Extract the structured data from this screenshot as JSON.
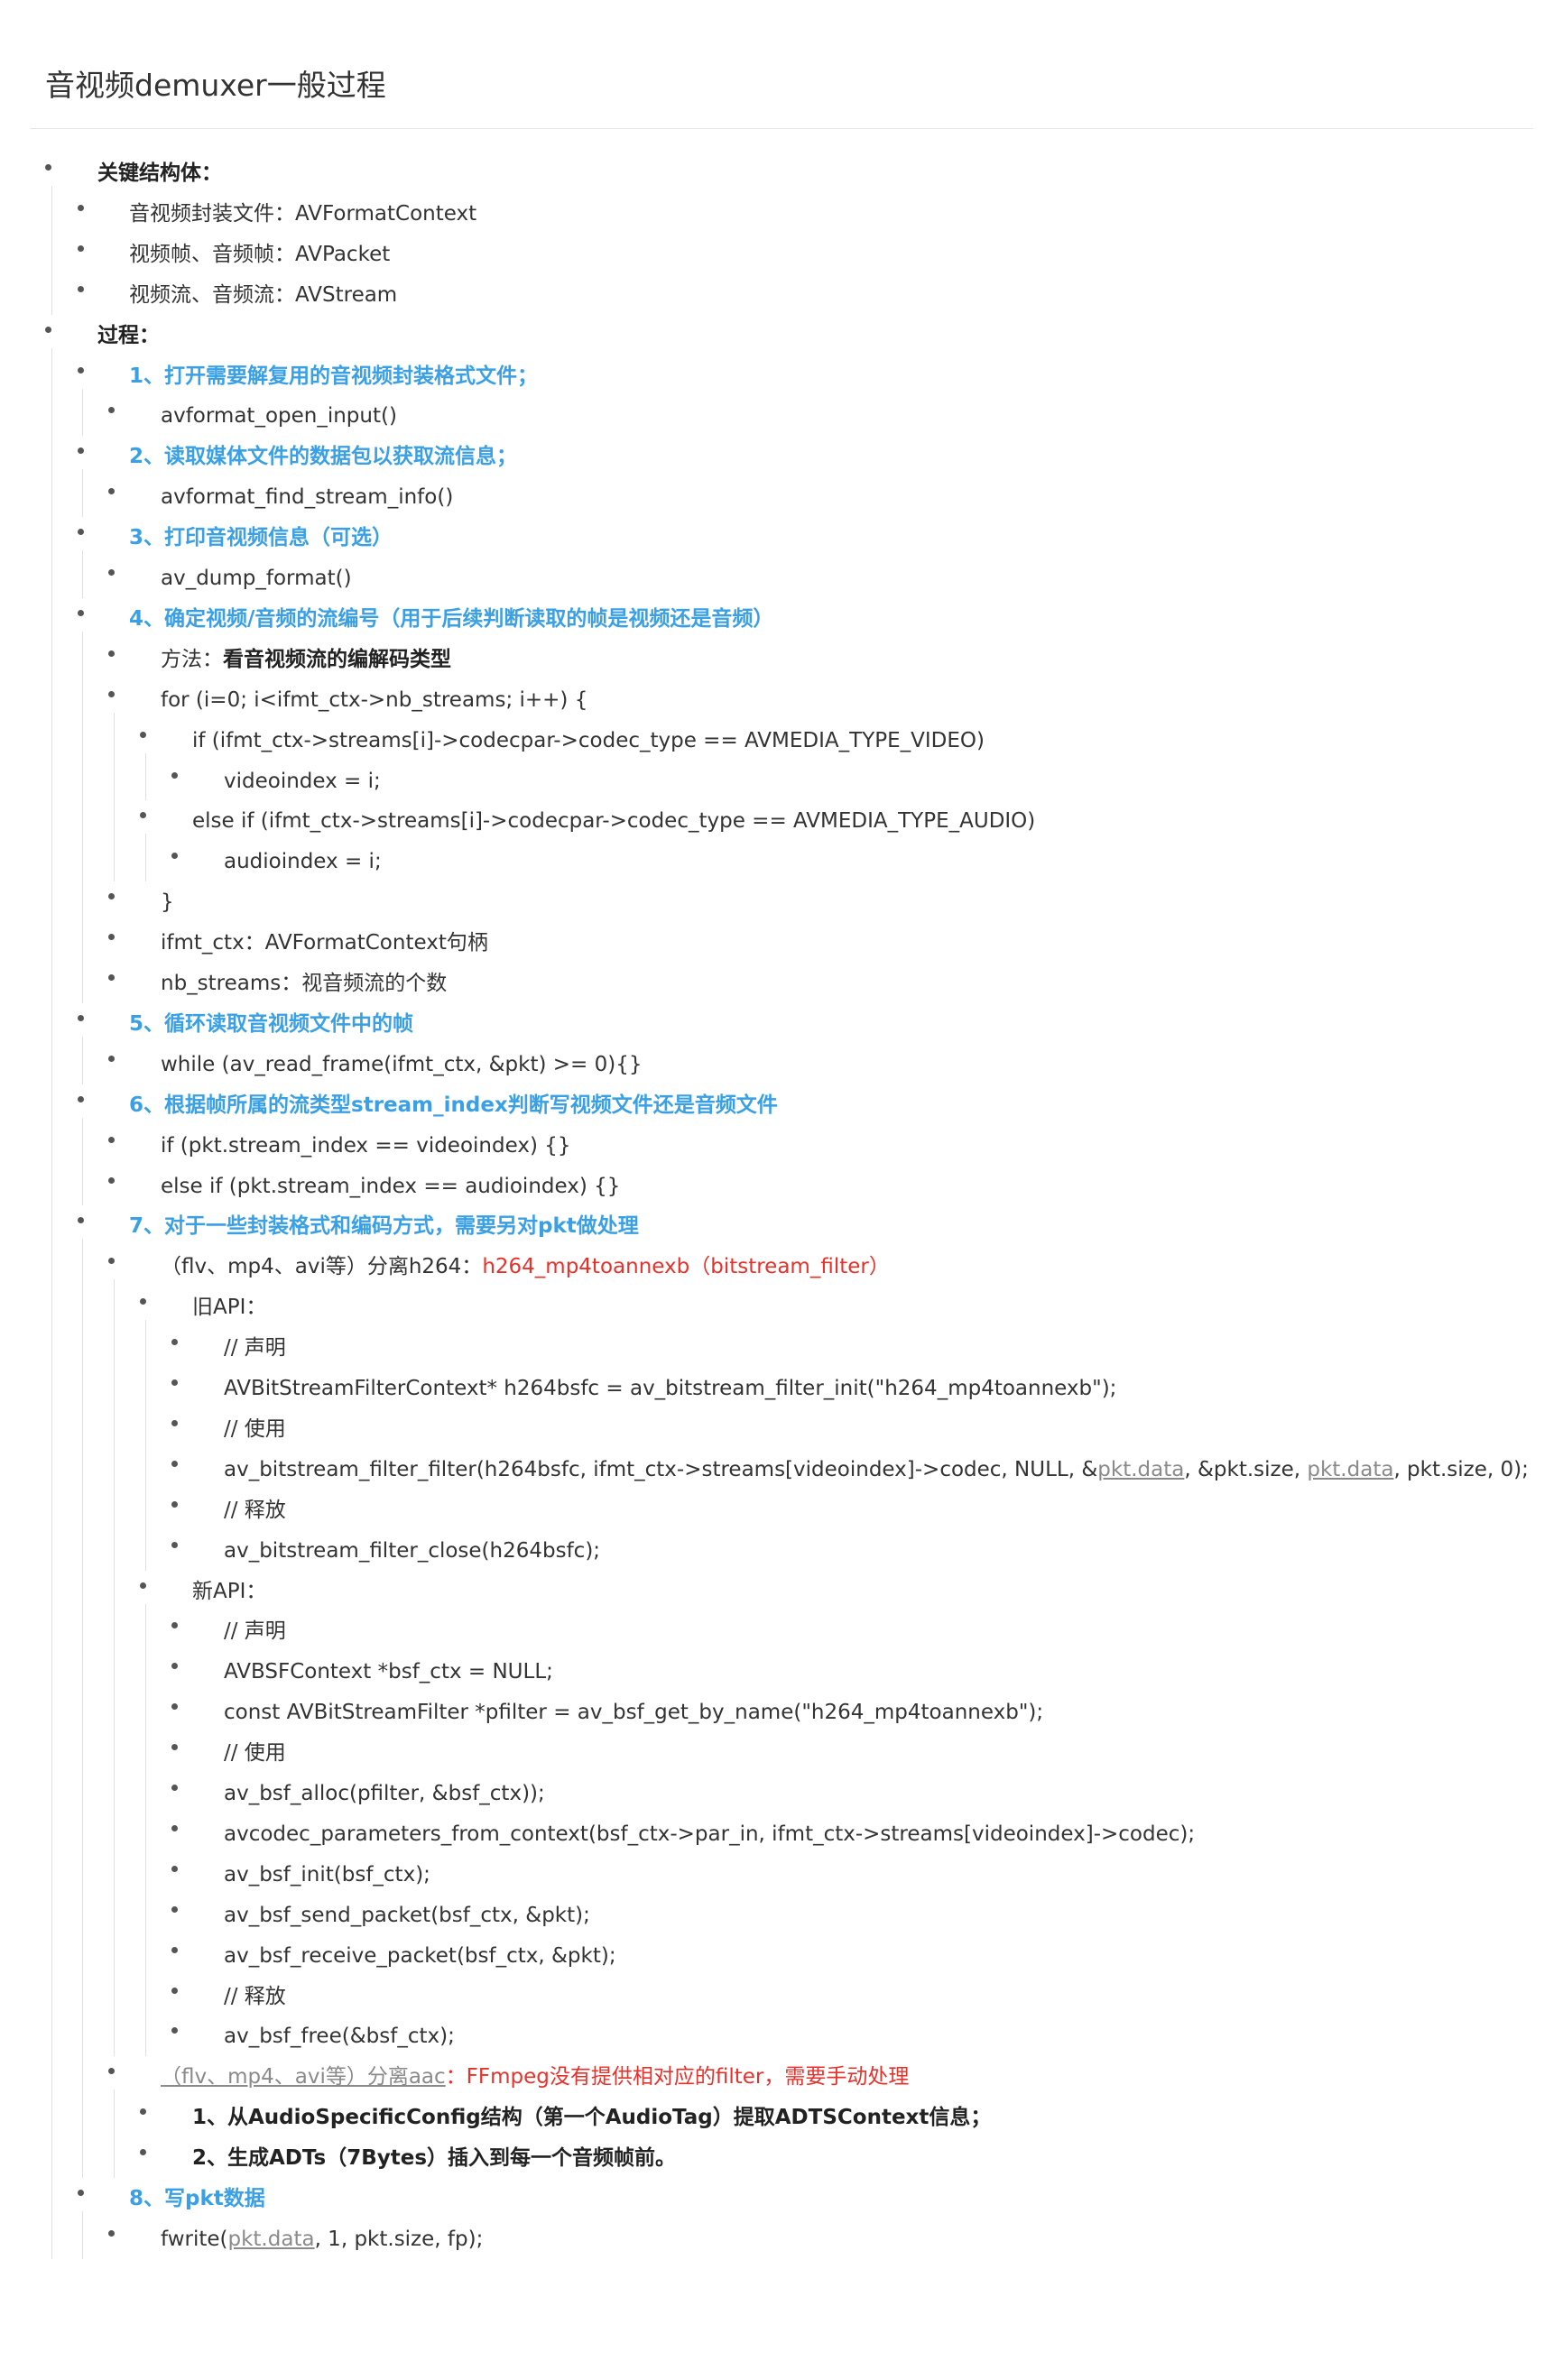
{
  "title": "音视频demuxer一般过程",
  "colors": {
    "heading_blue": "#3aa0e6",
    "emphasis_red": "#e8312a",
    "text": "#333333",
    "link_grey": "#8a8a8a"
  },
  "items": [
    {
      "level": 0,
      "segments": [
        {
          "t": "关键结构体：",
          "s": "bold"
        }
      ]
    },
    {
      "level": 1,
      "segments": [
        {
          "t": "音视频封装文件：AVFormatContext"
        }
      ]
    },
    {
      "level": 1,
      "segments": [
        {
          "t": "视频帧、音频帧：AVPacket"
        }
      ]
    },
    {
      "level": 1,
      "segments": [
        {
          "t": "视频流、音频流：AVStream"
        }
      ]
    },
    {
      "level": 0,
      "segments": [
        {
          "t": "过程：",
          "s": "bold"
        }
      ]
    },
    {
      "level": 1,
      "segments": [
        {
          "t": "1、打开需要解复用的音视频封装格式文件；",
          "s": "blue"
        }
      ]
    },
    {
      "level": 2,
      "segments": [
        {
          "t": "avformat_open_input()"
        }
      ]
    },
    {
      "level": 1,
      "segments": [
        {
          "t": "2、读取媒体文件的数据包以获取流信息；",
          "s": "blue"
        }
      ]
    },
    {
      "level": 2,
      "segments": [
        {
          "t": "avformat_find_stream_info()"
        }
      ]
    },
    {
      "level": 1,
      "segments": [
        {
          "t": "3、打印音视频信息（可选）",
          "s": "blue"
        }
      ]
    },
    {
      "level": 2,
      "segments": [
        {
          "t": "av_dump_format()"
        }
      ]
    },
    {
      "level": 1,
      "segments": [
        {
          "t": "4、确定视频/音频的流编号（用于后续判断读取的帧是视频还是音频）",
          "s": "blue"
        }
      ]
    },
    {
      "level": 2,
      "segments": [
        {
          "t": "方法："
        },
        {
          "t": "看音视频流的编解码类型",
          "s": "strong"
        }
      ]
    },
    {
      "level": 2,
      "segments": [
        {
          "t": "for (i=0; i<ifmt_ctx->nb_streams; i++) {"
        }
      ]
    },
    {
      "level": 3,
      "segments": [
        {
          "t": "if (ifmt_ctx->streams[i]->codecpar->codec_type == AVMEDIA_TYPE_VIDEO)"
        }
      ]
    },
    {
      "level": 4,
      "segments": [
        {
          "t": "videoindex = i;"
        }
      ]
    },
    {
      "level": 3,
      "segments": [
        {
          "t": "else if (ifmt_ctx->streams[i]->codecpar->codec_type == AVMEDIA_TYPE_AUDIO)"
        }
      ]
    },
    {
      "level": 4,
      "segments": [
        {
          "t": "audioindex = i;"
        }
      ]
    },
    {
      "level": 2,
      "segments": [
        {
          "t": "}"
        }
      ]
    },
    {
      "level": 2,
      "segments": [
        {
          "t": "ifmt_ctx：AVFormatContext句柄"
        }
      ]
    },
    {
      "level": 2,
      "segments": [
        {
          "t": "nb_streams：视音频流的个数"
        }
      ]
    },
    {
      "level": 1,
      "segments": [
        {
          "t": "5、循环读取音视频文件中的帧",
          "s": "blue"
        }
      ]
    },
    {
      "level": 2,
      "segments": [
        {
          "t": "while (av_read_frame(ifmt_ctx, &pkt) >= 0){}"
        }
      ]
    },
    {
      "level": 1,
      "segments": [
        {
          "t": "6、根据帧所属的流类型stream_index判断写视频文件还是音频文件",
          "s": "blue"
        }
      ]
    },
    {
      "level": 2,
      "segments": [
        {
          "t": "if (pkt.stream_index == videoindex) {}"
        }
      ]
    },
    {
      "level": 2,
      "segments": [
        {
          "t": "else if (pkt.stream_index == audioindex) {}"
        }
      ]
    },
    {
      "level": 1,
      "segments": [
        {
          "t": "7、对于一些封装格式和编码方式，需要另对pkt做处理",
          "s": "blue"
        }
      ]
    },
    {
      "level": 2,
      "segments": [
        {
          "t": "（flv、mp4、avi等）分离h264："
        },
        {
          "t": "h264_mp4toannexb（bitstream_filter）",
          "s": "red"
        }
      ]
    },
    {
      "level": 3,
      "segments": [
        {
          "t": "旧API："
        }
      ]
    },
    {
      "level": 4,
      "segments": [
        {
          "t": "// 声明"
        }
      ]
    },
    {
      "level": 4,
      "segments": [
        {
          "t": "AVBitStreamFilterContext* h264bsfc =  av_bitstream_filter_init(\"h264_mp4toannexb\");"
        }
      ]
    },
    {
      "level": 4,
      "segments": [
        {
          "t": "// 使用"
        }
      ]
    },
    {
      "level": 4,
      "segments": [
        {
          "t": "av_bitstream_filter_filter(h264bsfc, ifmt_ctx->streams[videoindex]->codec, NULL, &"
        },
        {
          "t": "pkt.data",
          "s": "link"
        },
        {
          "t": ", &pkt.size, "
        },
        {
          "t": "pkt.data",
          "s": "link"
        },
        {
          "t": ", pkt.size, 0);"
        }
      ]
    },
    {
      "level": 4,
      "segments": [
        {
          "t": "// 释放"
        }
      ]
    },
    {
      "level": 4,
      "segments": [
        {
          "t": "av_bitstream_filter_close(h264bsfc);"
        }
      ]
    },
    {
      "level": 3,
      "segments": [
        {
          "t": "新API："
        }
      ]
    },
    {
      "level": 4,
      "segments": [
        {
          "t": "// 声明"
        }
      ]
    },
    {
      "level": 4,
      "segments": [
        {
          "t": "AVBSFContext *bsf_ctx = NULL;"
        }
      ]
    },
    {
      "level": 4,
      "segments": [
        {
          "t": "const AVBitStreamFilter *pfilter = av_bsf_get_by_name(\"h264_mp4toannexb\");"
        }
      ]
    },
    {
      "level": 4,
      "segments": [
        {
          "t": "// 使用"
        }
      ]
    },
    {
      "level": 4,
      "segments": [
        {
          "t": "av_bsf_alloc(pfilter, &bsf_ctx));"
        }
      ]
    },
    {
      "level": 4,
      "segments": [
        {
          "t": "avcodec_parameters_from_context(bsf_ctx->par_in, ifmt_ctx->streams[videoindex]->codec);"
        }
      ]
    },
    {
      "level": 4,
      "segments": [
        {
          "t": "av_bsf_init(bsf_ctx);"
        }
      ]
    },
    {
      "level": 4,
      "segments": [
        {
          "t": "av_bsf_send_packet(bsf_ctx, &pkt);"
        }
      ]
    },
    {
      "level": 4,
      "segments": [
        {
          "t": "av_bsf_receive_packet(bsf_ctx, &pkt);"
        }
      ]
    },
    {
      "level": 4,
      "segments": [
        {
          "t": "// 释放"
        }
      ]
    },
    {
      "level": 4,
      "segments": [
        {
          "t": "av_bsf_free(&bsf_ctx);"
        }
      ]
    },
    {
      "level": 2,
      "segments": [
        {
          "t": "（flv、mp4、avi等）分离aac",
          "s": "link"
        },
        {
          "t": "：FFmpeg没有提供相对应的filter，需要手动处理",
          "s": "red"
        }
      ]
    },
    {
      "level": 3,
      "segments": [
        {
          "t": "1、从AudioSpecificConfig结构（第一个AudioTag）提取ADTSContext信息；",
          "s": "strong"
        }
      ]
    },
    {
      "level": 3,
      "segments": [
        {
          "t": "2、生成ADTs（7Bytes）插入到每一个音频帧前。",
          "s": "strong"
        }
      ]
    },
    {
      "level": 1,
      "segments": [
        {
          "t": "8、写pkt数据",
          "s": "blue"
        }
      ]
    },
    {
      "level": 2,
      "segments": [
        {
          "t": "fwrite("
        },
        {
          "t": "pkt.data",
          "s": "link"
        },
        {
          "t": ", 1, pkt.size, fp);"
        }
      ]
    }
  ]
}
